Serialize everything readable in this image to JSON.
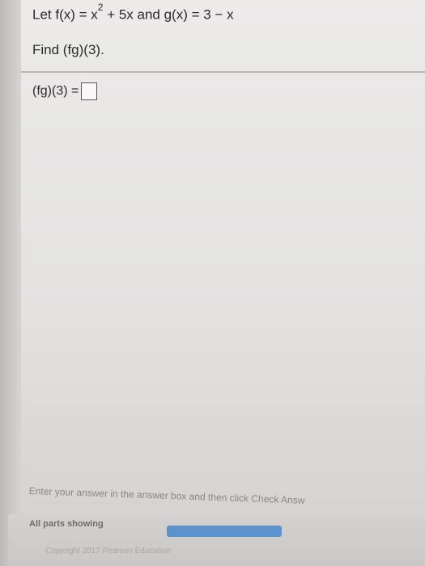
{
  "problem": {
    "let": "Let f(x) = x",
    "exponent": "2",
    "rest": " + 5x and g(x) = 3 − x"
  },
  "question": {
    "find": "Find (fg)(3)."
  },
  "answer": {
    "label": "(fg)(3) =",
    "value": ""
  },
  "footer": {
    "instruction": "Enter your answer in the answer box and then click Check Answ",
    "parts_showing": "All parts showing",
    "progress": 1.0,
    "progress_color": "#5b93cf",
    "copyright": "Copyright 2017 Pearson Education"
  }
}
